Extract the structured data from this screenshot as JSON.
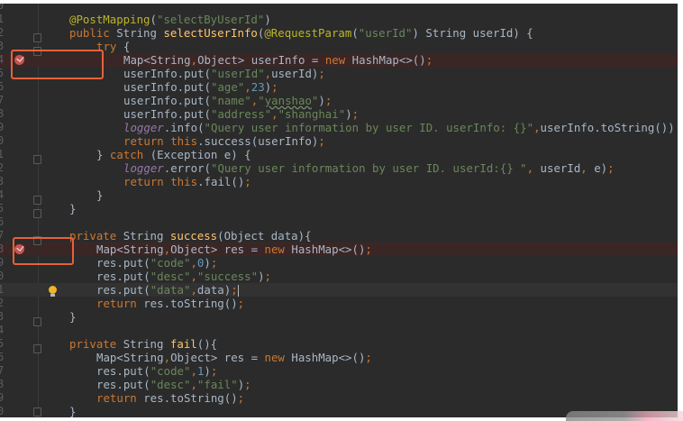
{
  "editor": {
    "colors": {
      "background": "#2B2B2B",
      "keyword": "#CC7832",
      "string": "#6A8759",
      "number": "#6897BB",
      "method": "#FFC66D",
      "annotation": "#BBB529",
      "field": "#9876AA",
      "breakpoint": "#C75450",
      "highlight_box": "#E5623A"
    },
    "lines": [
      {
        "num": "0",
        "indent": 0,
        "tokens": []
      },
      {
        "num": "1",
        "indent": 1,
        "tokens": [
          [
            "a",
            "@PostMapping"
          ],
          [
            "p",
            "("
          ],
          [
            "s",
            "\"selectByUserId\""
          ],
          [
            "p",
            ")"
          ]
        ]
      },
      {
        "num": "2",
        "indent": 1,
        "tokens": [
          [
            "k",
            "public "
          ],
          [
            "p",
            "String "
          ],
          [
            "m",
            "selectUserInfo"
          ],
          [
            "p",
            "("
          ],
          [
            "a",
            "@RequestParam"
          ],
          [
            "p",
            "("
          ],
          [
            "s",
            "\"userId\""
          ],
          [
            "p",
            ") String userId) {"
          ]
        ]
      },
      {
        "num": "3",
        "indent": 2,
        "tokens": [
          [
            "k",
            "try "
          ],
          [
            "p",
            "{"
          ]
        ]
      },
      {
        "num": "4",
        "indent": 3,
        "breakpoint": true,
        "tokens": [
          [
            "p",
            "Map<String"
          ],
          [
            "k",
            ","
          ],
          [
            "p",
            "Object> userInfo = "
          ],
          [
            "k",
            "new "
          ],
          [
            "p",
            "HashMap<>()"
          ],
          [
            "k",
            ";"
          ]
        ]
      },
      {
        "num": "5",
        "indent": 3,
        "tokens": [
          [
            "p",
            "userInfo.put("
          ],
          [
            "s",
            "\"userId\""
          ],
          [
            "k",
            ","
          ],
          [
            "p",
            "userId)"
          ],
          [
            "k",
            ";"
          ]
        ]
      },
      {
        "num": "6",
        "indent": 3,
        "tokens": [
          [
            "p",
            "userInfo.put("
          ],
          [
            "s",
            "\"age\""
          ],
          [
            "k",
            ","
          ],
          [
            "n",
            "23"
          ],
          [
            "p",
            ")"
          ],
          [
            "k",
            ";"
          ]
        ]
      },
      {
        "num": "7",
        "indent": 3,
        "tokens": [
          [
            "p",
            "userInfo.put("
          ],
          [
            "s",
            "\"name\""
          ],
          [
            "k",
            ","
          ],
          [
            "s",
            "\""
          ],
          [
            "sw",
            "yanshao"
          ],
          [
            "s",
            "\""
          ],
          [
            "p",
            ")"
          ],
          [
            "k",
            ";"
          ]
        ]
      },
      {
        "num": "8",
        "indent": 3,
        "tokens": [
          [
            "p",
            "userInfo.put("
          ],
          [
            "s",
            "\"address\""
          ],
          [
            "k",
            ","
          ],
          [
            "s",
            "\"shanghai\""
          ],
          [
            "p",
            ")"
          ],
          [
            "k",
            ";"
          ]
        ]
      },
      {
        "num": "9",
        "indent": 3,
        "tokens": [
          [
            "f",
            "logger"
          ],
          [
            "p",
            ".info("
          ],
          [
            "s",
            "\"Query user information by user ID. userInfo: {}\""
          ],
          [
            "k",
            ","
          ],
          [
            "p",
            "userInfo.toString())"
          ]
        ]
      },
      {
        "num": "0",
        "indent": 3,
        "tokens": [
          [
            "k",
            "return this"
          ],
          [
            "p",
            ".success(userInfo)"
          ],
          [
            "k",
            ";"
          ]
        ]
      },
      {
        "num": "1",
        "indent": 2,
        "tokens": [
          [
            "p",
            "} "
          ],
          [
            "k",
            "catch "
          ],
          [
            "p",
            "(Exception e) {"
          ]
        ]
      },
      {
        "num": "2",
        "indent": 3,
        "tokens": [
          [
            "f",
            "logger"
          ],
          [
            "p",
            ".error("
          ],
          [
            "s",
            "\"Query user information by user ID. userId:{} \""
          ],
          [
            "k",
            ", "
          ],
          [
            "p",
            "userId"
          ],
          [
            "k",
            ", "
          ],
          [
            "p",
            "e)"
          ],
          [
            "k",
            ";"
          ]
        ]
      },
      {
        "num": "3",
        "indent": 3,
        "tokens": [
          [
            "k",
            "return this"
          ],
          [
            "p",
            ".fail()"
          ],
          [
            "k",
            ";"
          ]
        ]
      },
      {
        "num": "4",
        "indent": 2,
        "tokens": [
          [
            "p",
            "}"
          ]
        ]
      },
      {
        "num": "5",
        "indent": 1,
        "tokens": [
          [
            "p",
            "}"
          ]
        ]
      },
      {
        "num": "6",
        "indent": 0,
        "tokens": []
      },
      {
        "num": "7",
        "indent": 1,
        "tokens": [
          [
            "k",
            "private "
          ],
          [
            "p",
            "String "
          ],
          [
            "m",
            "success"
          ],
          [
            "p",
            "(Object data){"
          ]
        ]
      },
      {
        "num": "8",
        "indent": 2,
        "breakpoint": true,
        "tokens": [
          [
            "p",
            "Map<String"
          ],
          [
            "k",
            ","
          ],
          [
            "p",
            "Object> res = "
          ],
          [
            "k",
            "new "
          ],
          [
            "p",
            "HashMap<>()"
          ],
          [
            "k",
            ";"
          ]
        ]
      },
      {
        "num": "9",
        "indent": 2,
        "tokens": [
          [
            "p",
            "res.put("
          ],
          [
            "s",
            "\"code\""
          ],
          [
            "k",
            ","
          ],
          [
            "n",
            "0"
          ],
          [
            "p",
            ")"
          ],
          [
            "k",
            ";"
          ]
        ]
      },
      {
        "num": "0",
        "indent": 2,
        "tokens": [
          [
            "p",
            "res.put("
          ],
          [
            "s",
            "\"desc\""
          ],
          [
            "k",
            ","
          ],
          [
            "s",
            "\"success\""
          ],
          [
            "p",
            ")"
          ],
          [
            "k",
            ";"
          ]
        ]
      },
      {
        "num": "1",
        "indent": 2,
        "caret": true,
        "tokens": [
          [
            "p",
            "res.put("
          ],
          [
            "s",
            "\"data\""
          ],
          [
            "k",
            ","
          ],
          [
            "p",
            "data)"
          ],
          [
            "k",
            ";"
          ],
          [
            "cur",
            ""
          ]
        ]
      },
      {
        "num": "2",
        "indent": 2,
        "tokens": [
          [
            "k",
            "return "
          ],
          [
            "p",
            "res.toString()"
          ],
          [
            "k",
            ";"
          ]
        ]
      },
      {
        "num": "3",
        "indent": 1,
        "tokens": [
          [
            "p",
            "}"
          ]
        ]
      },
      {
        "num": "4",
        "indent": 0,
        "tokens": []
      },
      {
        "num": "5",
        "indent": 1,
        "tokens": [
          [
            "k",
            "private "
          ],
          [
            "p",
            "String "
          ],
          [
            "m",
            "fail"
          ],
          [
            "p",
            "(){"
          ]
        ]
      },
      {
        "num": "6",
        "indent": 2,
        "tokens": [
          [
            "p",
            "Map<String"
          ],
          [
            "k",
            ","
          ],
          [
            "p",
            "Object> res = "
          ],
          [
            "k",
            "new "
          ],
          [
            "p",
            "HashMap<>()"
          ],
          [
            "k",
            ";"
          ]
        ]
      },
      {
        "num": "7",
        "indent": 2,
        "tokens": [
          [
            "p",
            "res.put("
          ],
          [
            "s",
            "\"code\""
          ],
          [
            "k",
            ","
          ],
          [
            "n",
            "1"
          ],
          [
            "p",
            ")"
          ],
          [
            "k",
            ";"
          ]
        ]
      },
      {
        "num": "8",
        "indent": 2,
        "tokens": [
          [
            "p",
            "res.put("
          ],
          [
            "s",
            "\"desc\""
          ],
          [
            "k",
            ","
          ],
          [
            "s",
            "\"fail\""
          ],
          [
            "p",
            ")"
          ],
          [
            "k",
            ";"
          ]
        ]
      },
      {
        "num": "9",
        "indent": 2,
        "tokens": [
          [
            "k",
            "return "
          ],
          [
            "p",
            "res.toString()"
          ],
          [
            "k",
            ";"
          ]
        ]
      },
      {
        "num": "0",
        "indent": 1,
        "tokens": [
          [
            "p",
            "}"
          ]
        ]
      }
    ]
  }
}
